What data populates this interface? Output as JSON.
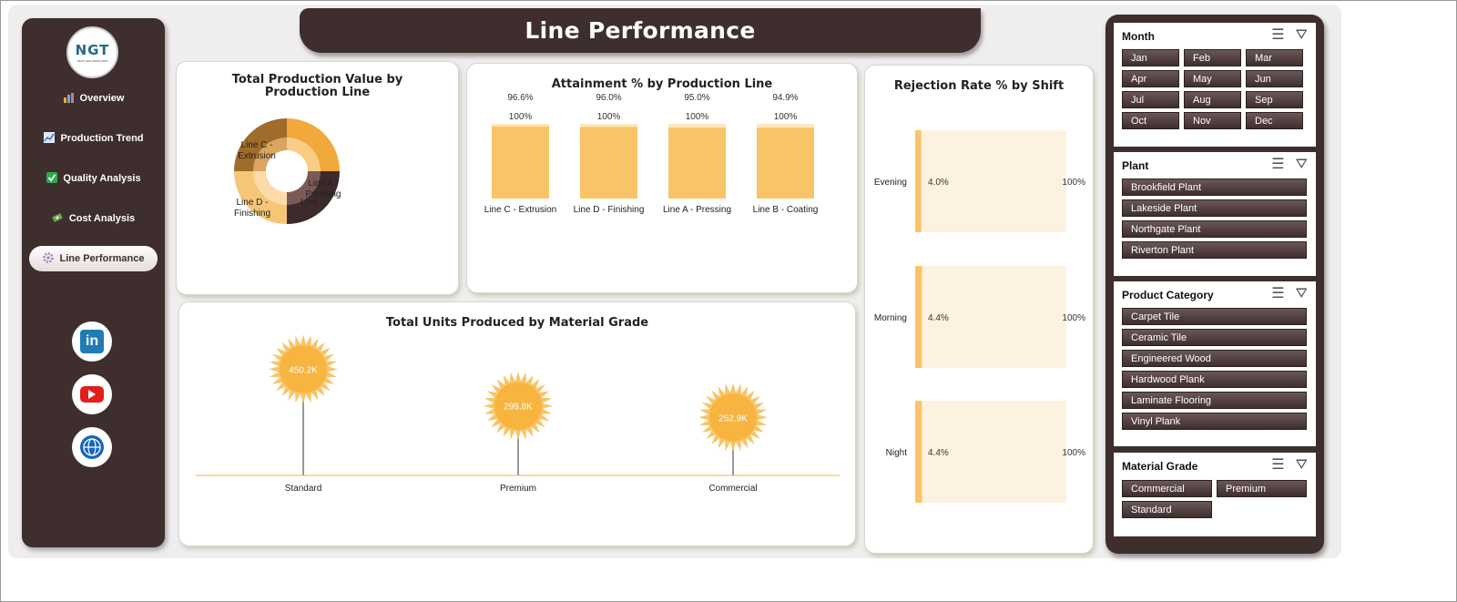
{
  "title": "Line Performance",
  "logo": {
    "text": "NGT",
    "subtext": "NEXT GEN TEMPLATES"
  },
  "nav": [
    {
      "label": "Overview",
      "icon": "bar-chart-icon"
    },
    {
      "label": "Production Trend",
      "icon": "trend-chart-icon"
    },
    {
      "label": "Quality Analysis",
      "icon": "checkmark-icon"
    },
    {
      "label": "Cost Analysis",
      "icon": "money-icon"
    },
    {
      "label": "Line Performance",
      "icon": "gear-icon"
    }
  ],
  "social": [
    "linkedin-icon",
    "youtube-icon",
    "globe-icon"
  ],
  "colors": {
    "sidebar": "#3f2e2e",
    "accent": "#f9c468",
    "light": "#fdf2e0"
  },
  "donut": {
    "title": "Total Production Value by Production Line",
    "chart_data": {
      "type": "pie",
      "categories": [
        "Line A - Pressing",
        "Line B - Coating",
        "Line D - Finishing",
        "Line C - Extrusion"
      ],
      "labels_shown": [
        "Line A - Pressing",
        "Line ...",
        "Line D - Finishing",
        "Line C - Extrusion"
      ],
      "values": [
        25,
        25,
        25,
        25
      ],
      "colors_outer": [
        "#f2a93b",
        "#3d2b2b",
        "#f7c576",
        "#a06c2a"
      ],
      "colors_inner": [
        "#f9cd85",
        "#7a5b55",
        "#fbdca9",
        "#d9a55f"
      ]
    }
  },
  "attainment": {
    "title": "Attainment % by Production Line",
    "chart_data": {
      "type": "bar",
      "categories": [
        "Line C - Extrusion",
        "Line D - Finishing",
        "Line A - Pressing",
        "Line B - Coating"
      ],
      "series": [
        {
          "values": [
            96.6,
            96.0,
            95.0,
            94.9
          ],
          "labels": [
            "96.6%",
            "96.0%",
            "95.0%",
            "94.9%"
          ]
        },
        {
          "values": [
            100,
            100,
            100,
            100
          ],
          "labels": [
            "100%",
            "100%",
            "100%",
            "100%"
          ]
        }
      ],
      "ylim": [
        0,
        100
      ]
    }
  },
  "rejection": {
    "title": "Rejection Rate % by Shift",
    "chart_data": {
      "type": "bar",
      "orientation": "horizontal",
      "categories": [
        "Evening",
        "Morning",
        "Night"
      ],
      "series": [
        {
          "values": [
            4.0,
            4.4,
            4.4
          ],
          "labels": [
            "4.0%",
            "4.4%",
            "4.4%"
          ]
        },
        {
          "values": [
            100,
            100,
            100
          ],
          "labels": [
            "100%",
            "100%",
            "100%"
          ]
        }
      ],
      "xlim": [
        0,
        100
      ]
    }
  },
  "units": {
    "title": "Total Units Produced by Material Grade",
    "chart_data": {
      "type": "bar",
      "categories": [
        "Standard",
        "Premium",
        "Commercial"
      ],
      "values": [
        450200,
        299800,
        252900
      ],
      "labels": [
        "450.2K",
        "299.8K",
        "252.9K"
      ],
      "ylim": [
        0,
        500000
      ]
    }
  },
  "slicers": [
    {
      "header": "Month",
      "items": [
        "Jan",
        "Feb",
        "Mar",
        "Apr",
        "May",
        "Jun",
        "Jul",
        "Aug",
        "Sep",
        "Oct",
        "Nov",
        "Dec"
      ]
    },
    {
      "header": "Plant",
      "items": [
        "Brookfield Plant",
        "Lakeside Plant",
        "Northgate Plant",
        "Riverton Plant"
      ]
    },
    {
      "header": "Product Category",
      "items": [
        "Carpet Tile",
        "Ceramic Tile",
        "Engineered Wood",
        "Hardwood Plank",
        "Laminate Flooring",
        "Vinyl Plank"
      ]
    },
    {
      "header": "Material Grade",
      "items": [
        "Commercial",
        "Premium",
        "Standard"
      ]
    }
  ]
}
